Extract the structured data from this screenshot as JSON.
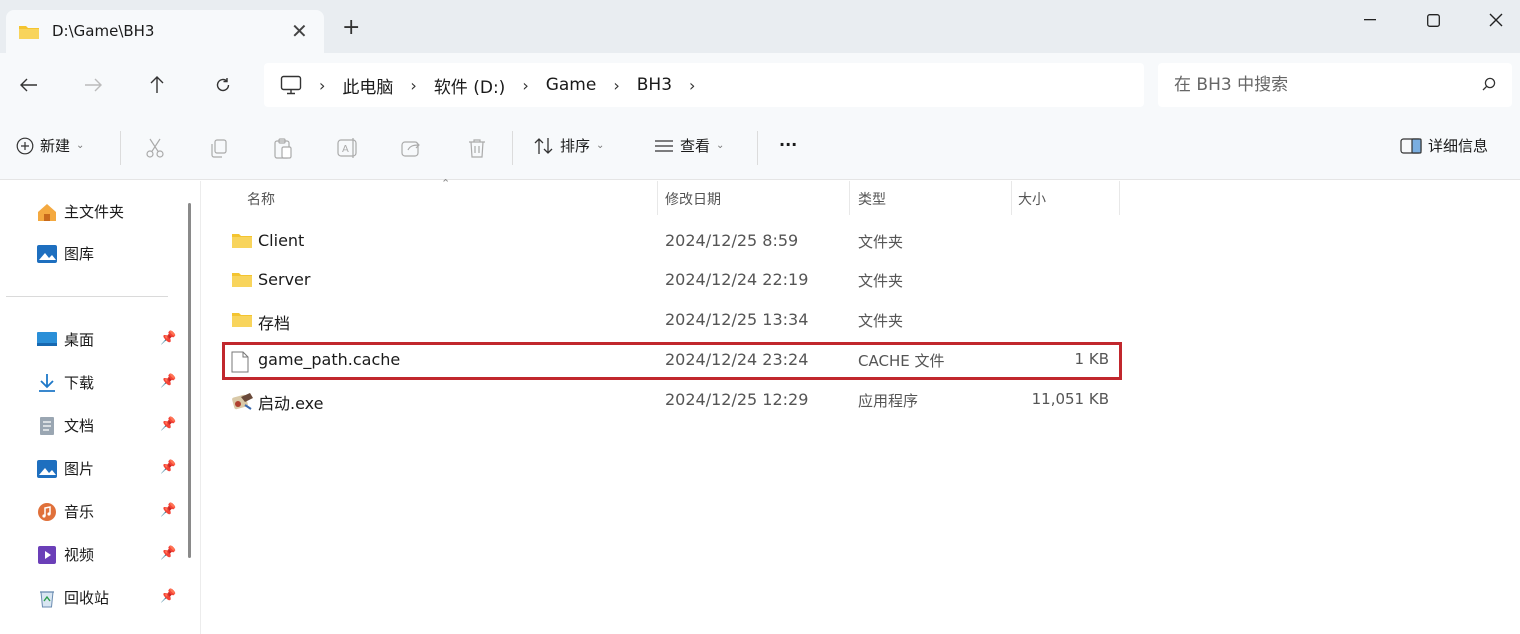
{
  "tab": {
    "title": "D:\\Game\\BH3",
    "close_glyph": "✕",
    "new_glyph": "+"
  },
  "window": {
    "minimize_glyph": "—",
    "close_glyph": "✕"
  },
  "nav": {
    "breadcrumb": [
      "此电脑",
      "软件 (D:)",
      "Game",
      "BH3"
    ],
    "breadcrumb_sep": "›",
    "search_placeholder": "在 BH3 中搜索"
  },
  "toolbar": {
    "new_label": "新建",
    "sort_label": "排序",
    "view_label": "查看",
    "more_label": "···",
    "details_label": "详细信息"
  },
  "sidebar": {
    "top_items": [
      {
        "label": "主文件夹",
        "icon": "home-icon"
      },
      {
        "label": "图库",
        "icon": "gallery-icon"
      }
    ],
    "pinned_items": [
      {
        "label": "桌面",
        "icon": "desktop-icon"
      },
      {
        "label": "下载",
        "icon": "download-icon"
      },
      {
        "label": "文档",
        "icon": "documents-icon"
      },
      {
        "label": "图片",
        "icon": "pictures-icon"
      },
      {
        "label": "音乐",
        "icon": "music-icon"
      },
      {
        "label": "视频",
        "icon": "videos-icon"
      },
      {
        "label": "回收站",
        "icon": "recycle-bin-icon"
      }
    ]
  },
  "filelist": {
    "columns": [
      "名称",
      "修改日期",
      "类型",
      "大小"
    ],
    "rows": [
      {
        "name": "Client",
        "date": "2024/12/25 8:59",
        "type": "文件夹",
        "size": "",
        "icon": "folder-icon"
      },
      {
        "name": "Server",
        "date": "2024/12/24 22:19",
        "type": "文件夹",
        "size": "",
        "icon": "folder-icon"
      },
      {
        "name": "存档",
        "date": "2024/12/25 13:34",
        "type": "文件夹",
        "size": "",
        "icon": "folder-icon"
      },
      {
        "name": "game_path.cache",
        "date": "2024/12/24 23:24",
        "type": "CACHE 文件",
        "size": "1 KB",
        "icon": "file-icon"
      },
      {
        "name": "启动.exe",
        "date": "2024/12/25 12:29",
        "type": "应用程序",
        "size": "11,051 KB",
        "icon": "exe-icon"
      }
    ],
    "highlighted_row": "game_path.cache",
    "highlight_color": "#c1272d"
  },
  "colors": {
    "folder": "#f4c430",
    "accent": "#0067c0"
  }
}
